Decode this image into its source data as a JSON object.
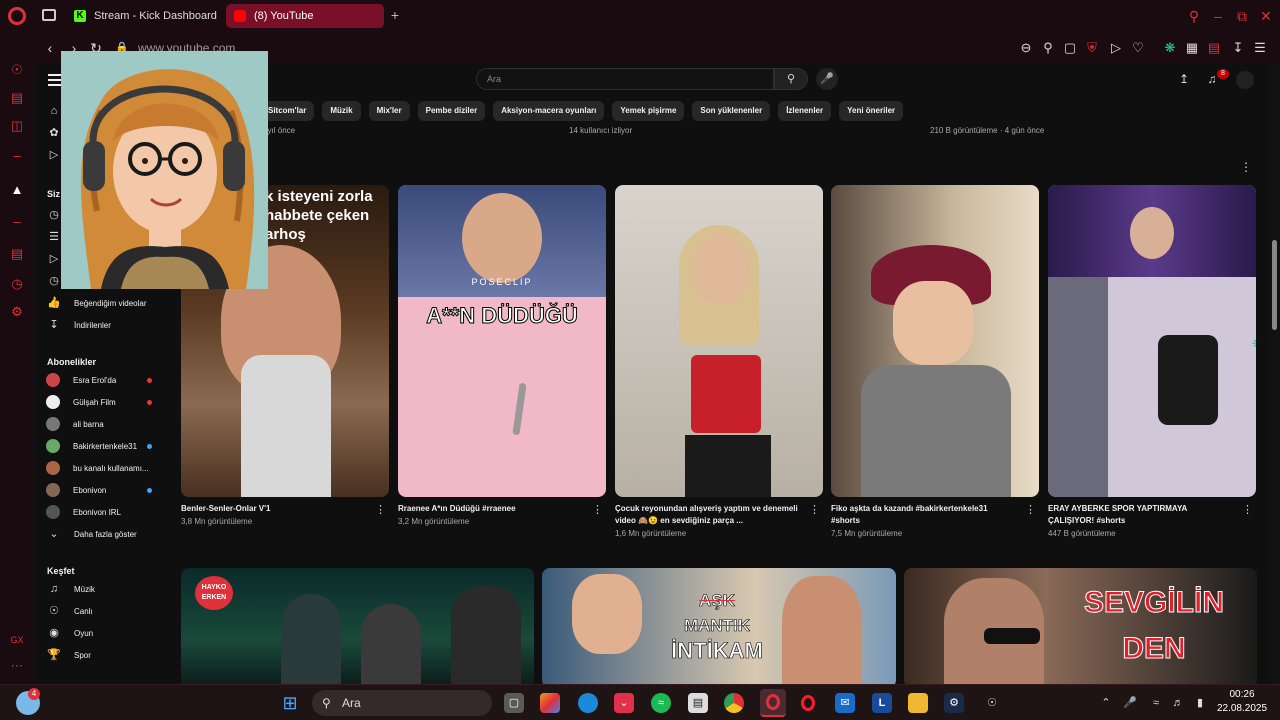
{
  "browser": {
    "tabs": [
      {
        "label": "Stream - Kick Dashboard",
        "icon": "kick-icon",
        "active": false
      },
      {
        "label": "(8) YouTube",
        "icon": "youtube-icon",
        "active": true
      }
    ],
    "url": "www.youtube.com",
    "kick_letter": "K"
  },
  "youtube": {
    "search_placeholder": "Ara",
    "notification_count": "8",
    "chips": [
      "Sitcom'lar",
      "Müzik",
      "Mix'ler",
      "Pembe diziler",
      "Aksiyon-macera oyunları",
      "Yemek pişirme",
      "Son yüklenenler",
      "İzlenenler",
      "Yeni öneriler"
    ],
    "prev_row_meta": [
      "· 1 yıl önce",
      "14 kullanıcı izliyor",
      "210 B görüntüleme · 4 gün önce"
    ],
    "guide": {
      "top_labels": [
        "Siz"
      ],
      "you_items": [
        {
          "label": "Beğendiğim videolar",
          "icon": "thumbs-up-icon"
        },
        {
          "label": "İndirilenler",
          "icon": "download-icon"
        }
      ],
      "subscriptions_header": "Abonelikler",
      "subscriptions": [
        {
          "label": "Esra Erol'da",
          "color": "#c44",
          "live": true
        },
        {
          "label": "Gülşah Film",
          "color": "#eee",
          "live": true
        },
        {
          "label": "ali barna",
          "color": "#777",
          "live": false
        },
        {
          "label": "Bakirkertenkele31",
          "color": "#6a6",
          "live": true
        },
        {
          "label": "bu kanalı kullanamı...",
          "color": "#a64",
          "live": false
        },
        {
          "label": "Ebonivon",
          "color": "#865",
          "live": true
        },
        {
          "label": "Ebonivon IRL",
          "color": "#555",
          "live": false
        }
      ],
      "show_more": "Daha fazla göster",
      "explore_header": "Keşfet",
      "explore": [
        {
          "label": "Müzik",
          "icon": "music-icon"
        },
        {
          "label": "Canlı",
          "icon": "live-icon"
        },
        {
          "label": "Oyun",
          "icon": "gaming-icon"
        },
        {
          "label": "Spor",
          "icon": "trophy-icon"
        }
      ]
    },
    "shorts": [
      {
        "title": "Benler-Senler-Onlar V'1",
        "views": "3,8 Mn görüntüleme",
        "overlay": "k isteyeni zorla|habbete çeken|arhoş"
      },
      {
        "title": "Rraenee A*ın Düdüğü  #rraenee",
        "views": "3,2 Mn görüntüleme",
        "overlay": "A**N DÜDÜĞÜ",
        "watermark": "POSECLIP"
      },
      {
        "title": "Çocuk reyonundan alışveriş yaptım ve denemeli video 🙈😉 en sevdiğiniz parça ...",
        "views": "1,6 Mn görüntüleme"
      },
      {
        "title": "Fiko aşkta da kazandı #bakirkertenkele31 #shorts",
        "views": "7,5 Mn görüntüleme"
      },
      {
        "title": "ERAY AYBERKE SPOR YAPTIRMAYA ÇALIŞIYOR! #shorts",
        "views": "447 B görüntüleme"
      }
    ],
    "videos": [
      {
        "overlay": "HAYKO ERKEN"
      },
      {
        "overlay_lines": [
          "AŞK",
          "MANTIK",
          "İNTİKAM"
        ]
      },
      {
        "overlay_lines": [
          "SEVGİLİN",
          "DEN"
        ]
      }
    ]
  },
  "taskbar": {
    "search_label": "Ara",
    "weather_badge": "4",
    "time": "00:26",
    "date": "22.08.2025"
  }
}
